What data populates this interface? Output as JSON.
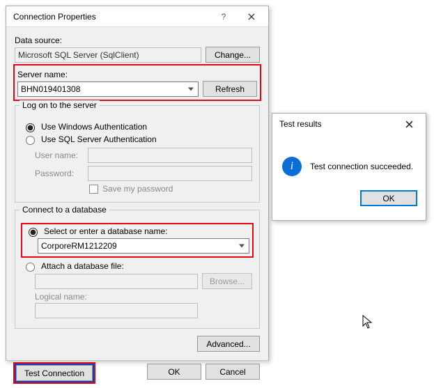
{
  "mainDialog": {
    "title": "Connection Properties",
    "dataSourceLabel": "Data source:",
    "dataSourceValue": "Microsoft SQL Server (SqlClient)",
    "changeBtn": "Change...",
    "serverNameLabel": "Server name:",
    "serverNameValue": "BHN019401308",
    "refreshBtn": "Refresh",
    "logonLegend": "Log on to the server",
    "useWindowsAuth": "Use Windows Authentication",
    "useSqlAuth": "Use SQL Server Authentication",
    "userNameLabel": "User name:",
    "passwordLabel": "Password:",
    "savePassword": "Save my password",
    "connectLegend": "Connect to a database",
    "selectDbLabel": "Select or enter a database name:",
    "dbName": "CorporeRM1212209",
    "attachDbLabel": "Attach a database file:",
    "browseBtn": "Browse...",
    "logicalNameLabel": "Logical name:",
    "advancedBtn": "Advanced...",
    "testConnBtn": "Test Connection",
    "okBtn": "OK",
    "cancelBtn": "Cancel"
  },
  "resultsDialog": {
    "title": "Test results",
    "message": "Test connection succeeded.",
    "okBtn": "OK"
  }
}
